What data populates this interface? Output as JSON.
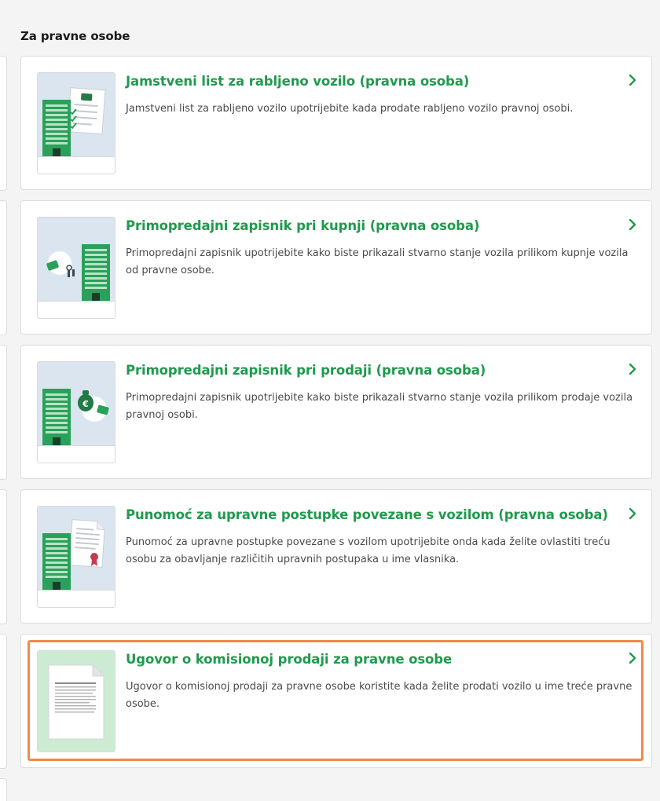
{
  "section": {
    "title": "Za pravne osobe"
  },
  "theme": {
    "accent": "#1f9a4d",
    "highlight": "#f08a4b"
  },
  "cards": [
    {
      "title": "Jamstveni list za rabljeno vozilo (pravna osoba)",
      "description": "Jamstveni list za rabljeno vozilo upotrijebite kada prodate rabljeno vozilo pravnoj osobi.",
      "icon": "building-warranty-icon"
    },
    {
      "title": "Primopredajni zapisnik pri kupnji (pravna osoba)",
      "description": "Primopredajni zapisnik upotrijebite kako biste prikazali stvarno stanje vozila prilikom kupnje vozila od pravne osobe.",
      "icon": "building-keys-icon"
    },
    {
      "title": "Primopredajni zapisnik pri prodaji (pravna osoba)",
      "description": "Primopredajni zapisnik upotrijebite kako biste prikazali stvarno stanje vozila prilikom prodaje vozila pravnoj osobi.",
      "icon": "building-money-icon"
    },
    {
      "title": "Punomoć za upravne postupke povezane s vozilom (pravna osoba)",
      "description": "Punomoć za upravne postupke povezane s vozilom upotrijebite onda kada želite ovlastiti treću osobu za obavljanje različitih upravnih postupaka u ime vlasnika.",
      "icon": "building-certificate-icon"
    },
    {
      "title": "Ugovor o komisionoj prodaji za pravne osobe",
      "description": "Ugovor o komisionoj prodaji za pravne osobe koristite kada želite prodati vozilo u ime treće pravne osobe.",
      "icon": "document-icon"
    }
  ]
}
